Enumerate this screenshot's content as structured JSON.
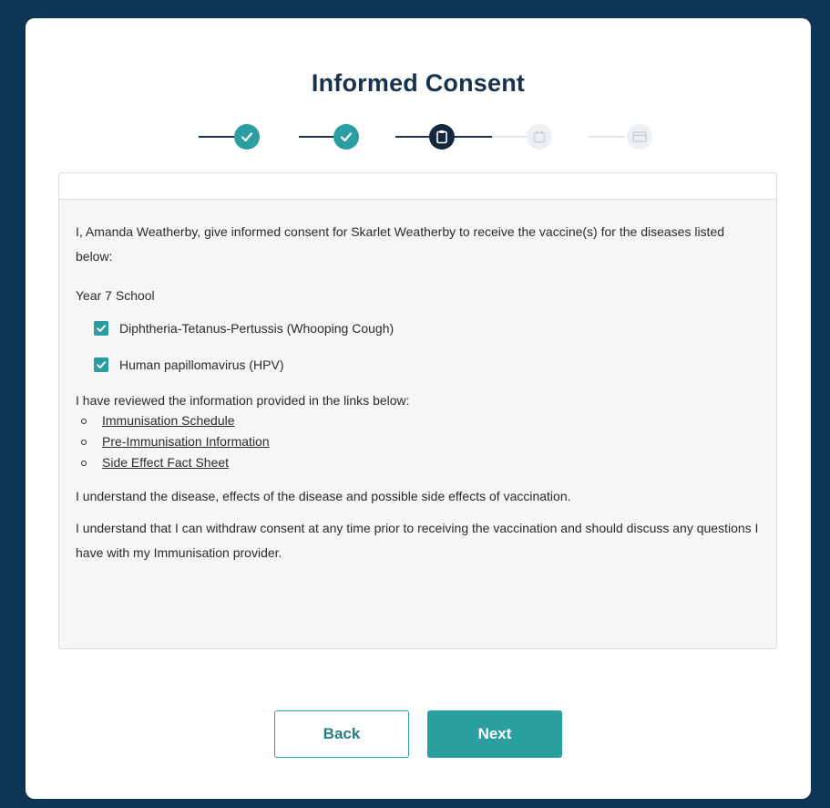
{
  "page": {
    "title": "Informed Consent"
  },
  "stepper": {
    "steps": [
      {
        "state": "done",
        "icon": "check-icon"
      },
      {
        "state": "done",
        "icon": "check-icon"
      },
      {
        "state": "current",
        "icon": "clipboard-icon"
      },
      {
        "state": "todo",
        "icon": "calendar-icon"
      },
      {
        "state": "todo",
        "icon": "card-icon"
      }
    ]
  },
  "consent": {
    "intro": "I, Amanda Weatherby, give informed consent for Skarlet Weatherby to receive the vaccine(s) for the diseases listed below:",
    "school": "Year 7 School",
    "vaccines": [
      {
        "label": "Diphtheria-Tetanus-Pertussis (Whooping Cough)",
        "checked": true
      },
      {
        "label": "Human papillomavirus (HPV)",
        "checked": true
      }
    ],
    "reviewed": "I have reviewed the information provided in the links below:",
    "links": [
      "Immunisation Schedule",
      "Pre-Immunisation Information",
      "Side Effect Fact Sheet"
    ],
    "understand": "I understand the disease, effects of the disease and possible side effects of vaccination.",
    "withdraw": "I understand that I can withdraw consent at any time prior to receiving the vaccination and should discuss any questions I have with my Immunisation provider."
  },
  "buttons": {
    "back": "Back",
    "next": "Next"
  },
  "colors": {
    "background": "#0e3556",
    "accent": "#2a9ea0",
    "title": "#16324f",
    "current_step": "#14283e"
  }
}
